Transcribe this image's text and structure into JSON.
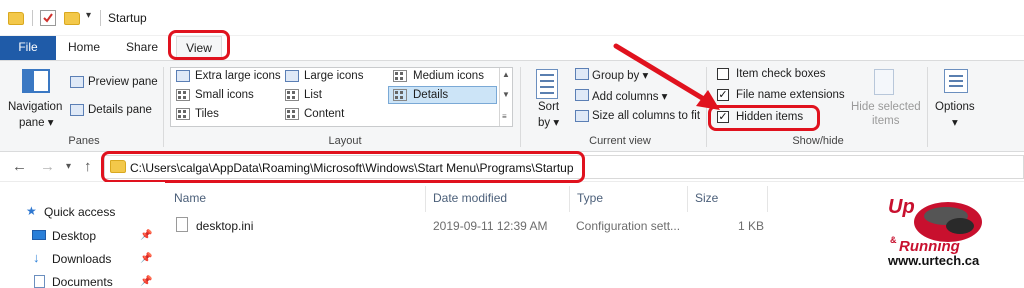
{
  "window": {
    "title": "Startup"
  },
  "tabs": {
    "file": "File",
    "home": "Home",
    "share": "Share",
    "view": "View"
  },
  "ribbon": {
    "panes": {
      "navigation_pane": "Navigation",
      "navigation_pane_2": "pane ▾",
      "preview_pane": "Preview pane",
      "details_pane": "Details pane",
      "label": "Panes"
    },
    "layout": {
      "extra_large_icons": "Extra large icons",
      "large_icons": "Large icons",
      "medium_icons": "Medium icons",
      "small_icons": "Small icons",
      "list": "List",
      "details": "Details",
      "tiles": "Tiles",
      "content": "Content",
      "label": "Layout",
      "selected": "Details"
    },
    "current_view": {
      "sort_by": "Sort",
      "sort_by_2": "by ▾",
      "group_by": "Group by ▾",
      "add_columns": "Add columns ▾",
      "size_all_columns": "Size all columns to fit",
      "label": "Current view"
    },
    "show_hide": {
      "item_check_boxes": "Item check boxes",
      "file_name_extensions": "File name extensions",
      "hidden_items": "Hidden items",
      "hide_selected_items": "Hide selected",
      "hide_selected_items_2": "items",
      "label": "Show/hide",
      "item_check_boxes_checked": false,
      "file_name_extensions_checked": true,
      "hidden_items_checked": true
    },
    "options": {
      "label": "Options",
      "arrow": "▾"
    }
  },
  "address_bar": {
    "path": "C:\\Users\\calga\\AppData\\Roaming\\Microsoft\\Windows\\Start Menu\\Programs\\Startup"
  },
  "nav_pane": {
    "items": [
      {
        "label": "Quick access",
        "icon": "star-icon"
      },
      {
        "label": "Desktop",
        "icon": "desktop-icon"
      },
      {
        "label": "Downloads",
        "icon": "download-icon"
      },
      {
        "label": "Documents",
        "icon": "document-icon"
      }
    ]
  },
  "file_list": {
    "columns": [
      "Name",
      "Date modified",
      "Type",
      "Size"
    ],
    "rows": [
      {
        "name": "desktop.ini",
        "date_modified": "2019-09-11 12:39 AM",
        "type": "Configuration sett...",
        "size": "1 KB"
      }
    ]
  },
  "watermark": {
    "logo_top": "Up",
    "logo_amp": "&",
    "logo_running": "Running",
    "url": "www.urtech.ca"
  },
  "colors": {
    "accent": "#1f5ba8",
    "annotation_red": "#e0121e",
    "selection": "#cce4f7"
  }
}
